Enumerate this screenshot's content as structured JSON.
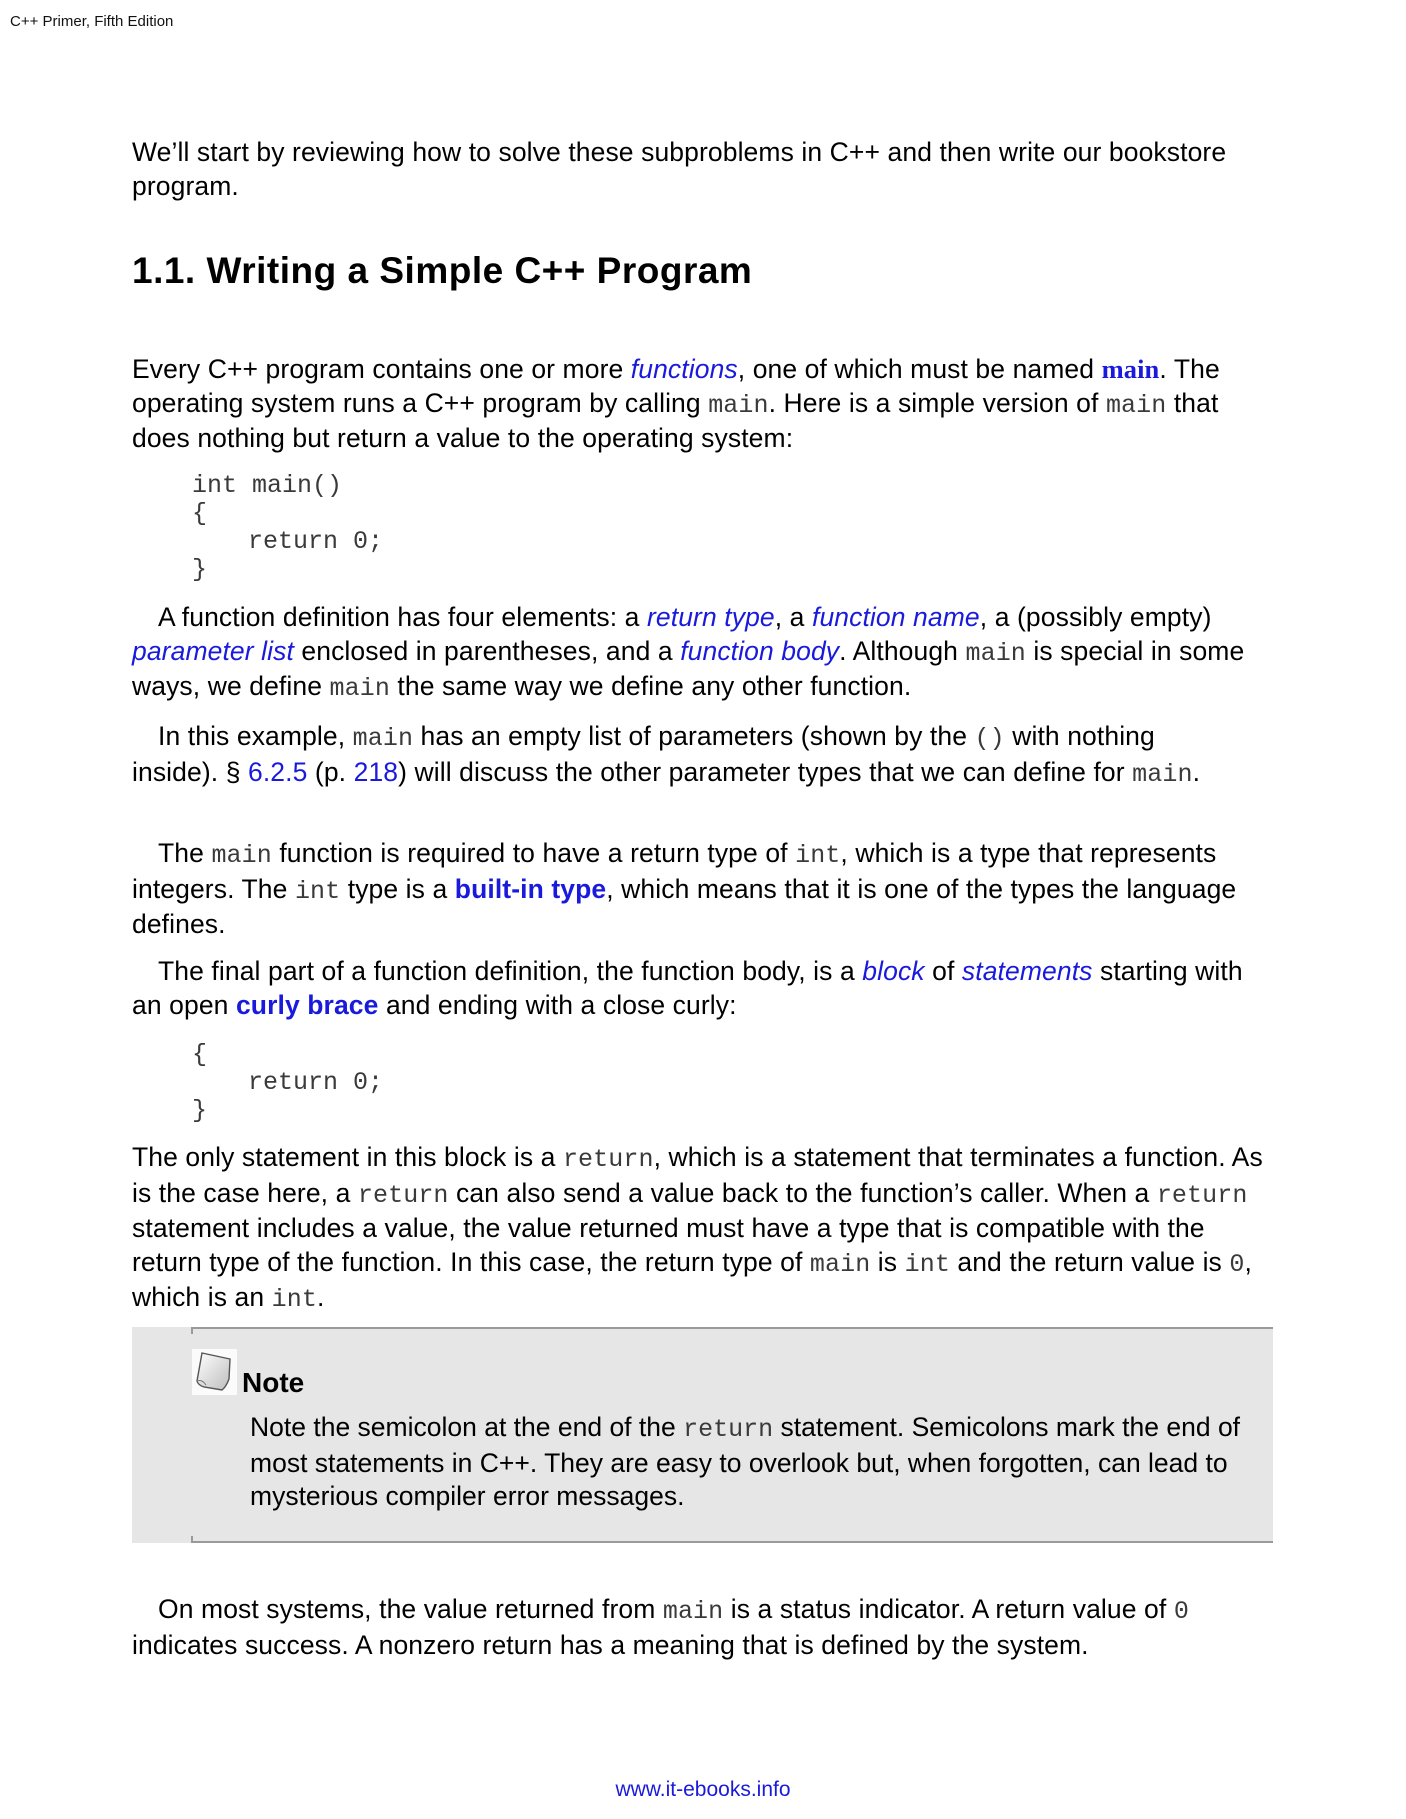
{
  "running_head": "C++ Primer, Fifth Edition",
  "intro": {
    "text": "We’ll start by reviewing how to solve these subproblems in C++ and then write our bookstore program."
  },
  "section": {
    "title": "1.1. Writing a Simple C++ Program"
  },
  "p1": {
    "a": "Every C++ program contains one or more ",
    "term_functions": "functions",
    "b": ", one of which must be named ",
    "term_main": "main",
    "c": ". The operating system runs a C++ program by calling ",
    "code_main1": "main",
    "d": ". Here is a simple version of ",
    "code_main2": "main",
    "e": " that does nothing but return a value to the operating system:"
  },
  "code1": {
    "line1": "int main()",
    "line2": "{",
    "line3": "return 0;",
    "line4": "}"
  },
  "p2": {
    "a": "A function definition has four elements: a ",
    "term_return_type": "return type",
    "b": ", a ",
    "term_function_name": "function name",
    "c": ", a (possibly empty) ",
    "term_parameter_list": "parameter list",
    "d": " enclosed in parentheses, and a ",
    "term_function_body": "function body",
    "e": ". Although ",
    "code_main1": "main",
    "f": " is special in some ways, we define ",
    "code_main2": "main",
    "g": " the same way we define any other function."
  },
  "p3": {
    "a": "In this example, ",
    "code_main1": "main",
    "b": " has an empty list of parameters (shown by the ",
    "code_parens": "()",
    "c": " with nothing inside). § ",
    "link_section": "6.2.5",
    "d": " (p. ",
    "link_page": "218",
    "e": ") will discuss the other parameter types that we can define for ",
    "code_main2": "main",
    "f": "."
  },
  "p4": {
    "a": "The ",
    "code_main": "main",
    "b": " function is required to have a return type of ",
    "code_int1": "int",
    "c": ", which is a type that represents integers. The ",
    "code_int2": "int",
    "d": " type is a ",
    "term_builtin": "built-in type",
    "e": ", which means that it is one of the types the language defines."
  },
  "p5": {
    "a": "The final part of a function definition, the function body, is a ",
    "term_block": "block",
    "b": " of ",
    "term_statements": "statements",
    "c": " starting with an open ",
    "term_curly": "curly brace",
    "d": " and ending with a close curly:"
  },
  "code2": {
    "line1": "{",
    "line2": "return 0;",
    "line3": "}"
  },
  "p6": {
    "a": "The only statement in this block is a ",
    "code_return1": "return",
    "b": ", which is a statement that terminates a function. As is the case here, a ",
    "code_return2": "return",
    "c": " can also send a value back to the function’s caller. When a ",
    "code_return3": "return",
    "d": " statement includes a value, the value returned must have a type that is compatible with the return type of the function. In this case, the return type of ",
    "code_main": "main",
    "e": " is ",
    "code_int1": "int",
    "f": " and the return value is ",
    "code_zero": "0",
    "g": ", which is an ",
    "code_int2": "int",
    "h": "."
  },
  "note": {
    "title": "Note",
    "icon": "note-paper-icon",
    "a": "Note the semicolon at the end of the ",
    "code_return": "return",
    "b": " statement. Semicolons mark the end of most statements in C++. They are easy to overlook but, when forgotten, can lead to mysterious compiler error messages."
  },
  "p7": {
    "a": "On most systems, the value returned from ",
    "code_main": "main",
    "b": " is a status indicator. A return value of ",
    "code_zero": "0",
    "c": " indicates success. A nonzero return has a meaning that is defined by the system."
  },
  "footer": {
    "link": "www.it-ebooks.info"
  },
  "colors": {
    "link": "#1a1adc",
    "note_background": "#e6e6e6",
    "note_rule": "#9a9a9a",
    "code_text": "#3a3a3a"
  }
}
